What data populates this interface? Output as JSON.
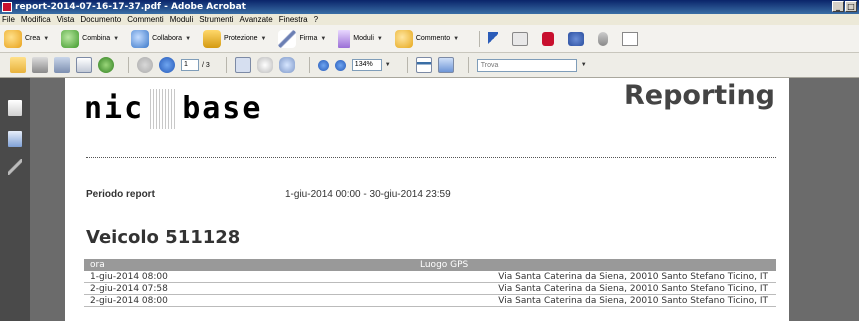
{
  "window": {
    "title": "report-2014-07-16-17-37.pdf - Adobe Acrobat",
    "buttons": [
      "_",
      "□"
    ]
  },
  "menu": [
    "File",
    "Modifica",
    "Vista",
    "Documento",
    "Commenti",
    "Moduli",
    "Strumenti",
    "Avanzate",
    "Finestra",
    "?"
  ],
  "toolbar1": {
    "crea": "Crea",
    "combina": "Combina",
    "collabora": "Collabora",
    "protezione": "Protezione",
    "firma": "Firma",
    "moduli": "Moduli",
    "commento": "Commento"
  },
  "toolbar2": {
    "page_current": "1",
    "page_total": "/ 3",
    "zoom": "134%",
    "find_placeholder": "Trova"
  },
  "document": {
    "logo_left": "nic",
    "logo_right": "base",
    "heading": "Reporting",
    "periodo_label": "Periodo report",
    "periodo_value": "1-giu-2014 00:00 - 30-giu-2014 23:59",
    "vehicle_title": "Veicolo 511128",
    "table": {
      "headers": [
        "ora",
        "Luogo GPS"
      ],
      "rows": [
        {
          "ora": "1-giu-2014 08:00",
          "luogo": "Via Santa Caterina da Siena, 20010 Santo Stefano Ticino, IT"
        },
        {
          "ora": "2-giu-2014 07:58",
          "luogo": "Via Santa Caterina da Siena, 20010 Santo Stefano Ticino, IT"
        },
        {
          "ora": "2-giu-2014 08:00",
          "luogo": "Via Santa Caterina da Siena, 20010 Santo Stefano Ticino, IT"
        }
      ]
    }
  }
}
